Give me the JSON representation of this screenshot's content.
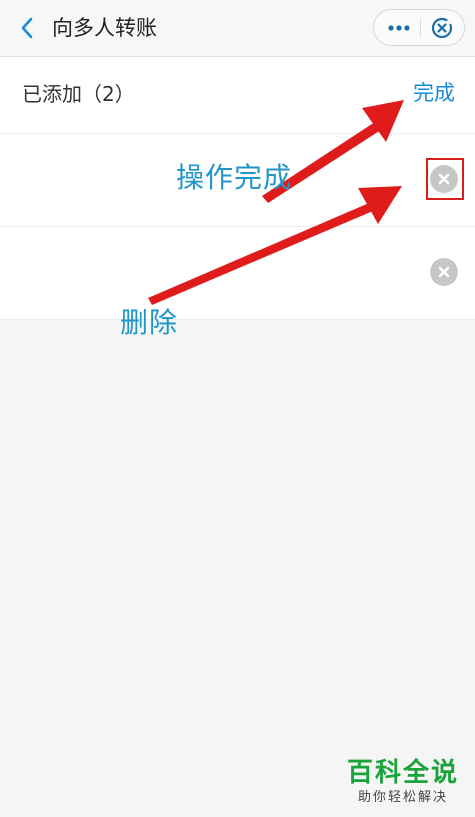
{
  "navbar": {
    "back_icon": "chevron-left-icon",
    "title": "向多人转账",
    "more_icon": "more-dots-icon",
    "close_icon": "close-circle-icon"
  },
  "section": {
    "added_label": "已添加（2）",
    "done_label": "完成"
  },
  "list": {
    "items": [
      {
        "remove_icon": "remove-circle-icon"
      },
      {
        "remove_icon": "remove-circle-icon"
      }
    ]
  },
  "annotations": {
    "done_text": "操作完成",
    "delete_text": "删除",
    "arrow_color": "#e01b1b",
    "text_color": "#2196c9"
  },
  "watermark": {
    "main": "百科全说",
    "sub": "助你轻松解决"
  },
  "colors": {
    "accent": "#1a8cd8",
    "background": "#f5f5f5",
    "highlight": "#d91c1c",
    "watermark_green": "#1aa33a"
  }
}
